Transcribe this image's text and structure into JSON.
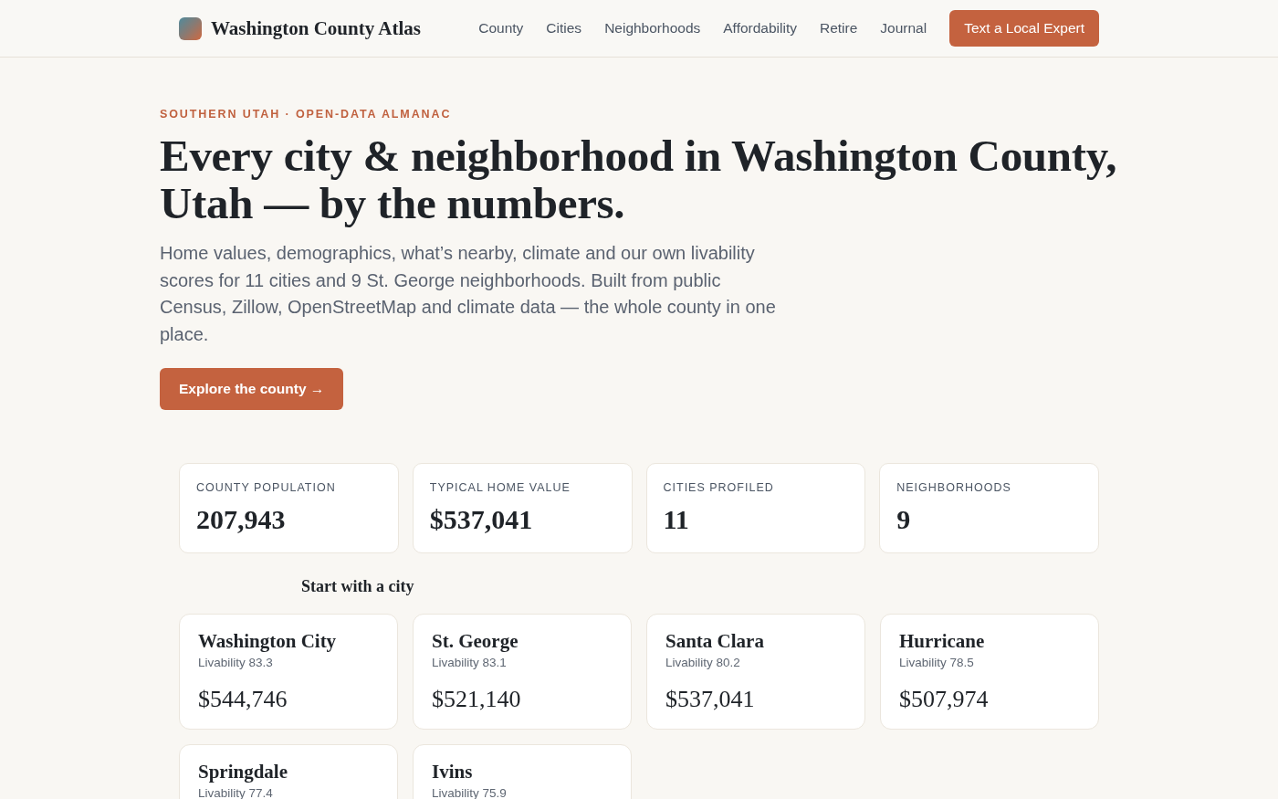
{
  "header": {
    "brand": "Washington County Atlas",
    "nav": [
      {
        "label": "County"
      },
      {
        "label": "Cities"
      },
      {
        "label": "Neighborhoods"
      },
      {
        "label": "Affordability"
      },
      {
        "label": "Retire"
      },
      {
        "label": "Journal"
      }
    ],
    "cta": "Text a Local Expert"
  },
  "hero": {
    "eyebrow": "SOUTHERN UTAH · OPEN-DATA ALMANAC",
    "title": "Every city & neighborhood in Washington County, Utah — by the numbers.",
    "lead": "Home values, demographics, what’s nearby, climate and our own livability scores for 11 cities and 9 St. George neighborhoods. Built from public Census, Zillow, OpenStreetMap and climate data — the whole county in one place.",
    "button": "Explore the county →"
  },
  "stats": [
    {
      "label": "COUNTY POPULATION",
      "value": "207,943"
    },
    {
      "label": "TYPICAL HOME VALUE",
      "value": "$537,041"
    },
    {
      "label": "CITIES PROFILED",
      "value": "11"
    },
    {
      "label": "NEIGHBORHOODS",
      "value": "9"
    }
  ],
  "cities_heading": "Start with a city",
  "cities": [
    {
      "name": "Washington City",
      "livability": "Livability 83.3",
      "price": "$544,746"
    },
    {
      "name": "St. George",
      "livability": "Livability 83.1",
      "price": "$521,140"
    },
    {
      "name": "Santa Clara",
      "livability": "Livability 80.2",
      "price": "$537,041"
    },
    {
      "name": "Hurricane",
      "livability": "Livability 78.5",
      "price": "$507,974"
    },
    {
      "name": "Springdale",
      "livability": "Livability 77.4"
    },
    {
      "name": "Ivins",
      "livability": "Livability 75.9"
    }
  ]
}
